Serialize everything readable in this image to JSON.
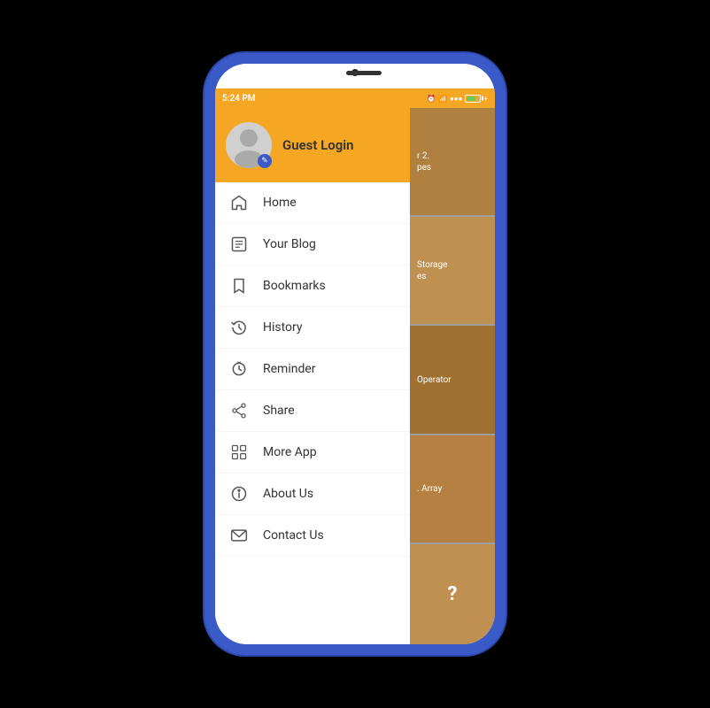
{
  "phone": {
    "status_bar": {
      "time": "5:24 PM",
      "battery_label": "battery"
    },
    "drawer": {
      "header": {
        "username": "Guest Login"
      },
      "menu_items": [
        {
          "id": "home",
          "label": "Home",
          "icon": "home"
        },
        {
          "id": "your-blog",
          "label": "Your Blog",
          "icon": "blog"
        },
        {
          "id": "bookmarks",
          "label": "Bookmarks",
          "icon": "bookmark"
        },
        {
          "id": "history",
          "label": "History",
          "icon": "history"
        },
        {
          "id": "reminder",
          "label": "Reminder",
          "icon": "reminder"
        },
        {
          "id": "share",
          "label": "Share",
          "icon": "share"
        },
        {
          "id": "more-app",
          "label": "More App",
          "icon": "grid"
        },
        {
          "id": "about-us",
          "label": "About Us",
          "icon": "info"
        },
        {
          "id": "contact-us",
          "label": "Contact Us",
          "icon": "email"
        }
      ]
    },
    "right_content": {
      "cards": [
        {
          "text": "r 2.\npes"
        },
        {
          "text": "Storage\nes"
        },
        {
          "text": "Operator"
        },
        {
          "text": ". Array"
        },
        {
          "text": "?"
        }
      ]
    }
  }
}
